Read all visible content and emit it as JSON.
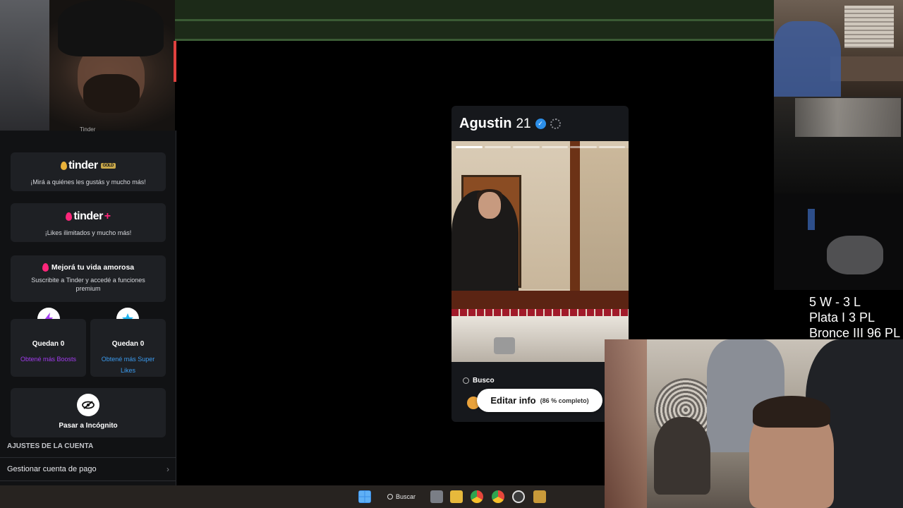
{
  "sidebar": {
    "cut_text": "Tinder",
    "gold": {
      "brand": "tinder",
      "badge": "GOLD",
      "tagline": "¡Mirá a quiénes les gustás y mucho más!"
    },
    "plus": {
      "brand": "tinder",
      "plus_mark": "+",
      "tagline": "¡Likes ilimitados y mucho más!"
    },
    "love": {
      "title": "Mejorá tu vida amorosa",
      "subtitle": "Suscribite a Tinder y accedé a funciones premium"
    },
    "boosts": {
      "count": "Quedan 0",
      "link": "Obtené más Boosts"
    },
    "super_likes": {
      "count": "Quedan 0",
      "link": "Obtené más Super Likes"
    },
    "incognito": {
      "label": "Pasar a Incógnito"
    },
    "section_title": "AJUSTES DE LA CUENTA",
    "menu_item": "Gestionar cuenta de pago"
  },
  "profile": {
    "name": "Agustin",
    "age": "21",
    "search_label": "Busco",
    "edit_button": "Editar info",
    "completion": "(86 % completo)"
  },
  "stats": {
    "line1": "5 W - 3 L",
    "line2": "Plata I 3 PL",
    "line3": "Bronce III 96 PL"
  },
  "taskbar": {
    "search_label": "Buscar"
  },
  "colors": {
    "tinder_pink": "#fd267a",
    "gold": "#c9a84a",
    "boost_purple": "#a33cf0",
    "superlike_blue": "#1eb4f0",
    "link_blue": "#3b9bef"
  }
}
